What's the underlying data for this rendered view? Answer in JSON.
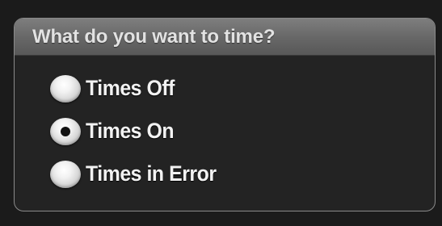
{
  "panel": {
    "title": "What do you want to time?"
  },
  "options": [
    {
      "label": "Times Off",
      "checked": false
    },
    {
      "label": "Times On",
      "checked": true
    },
    {
      "label": "Times in Error",
      "checked": false
    }
  ],
  "colors": {
    "background": "#1b1b1b",
    "panel_body": "#232323",
    "header": "#6e6e6e",
    "text": "#f2f2f2"
  }
}
